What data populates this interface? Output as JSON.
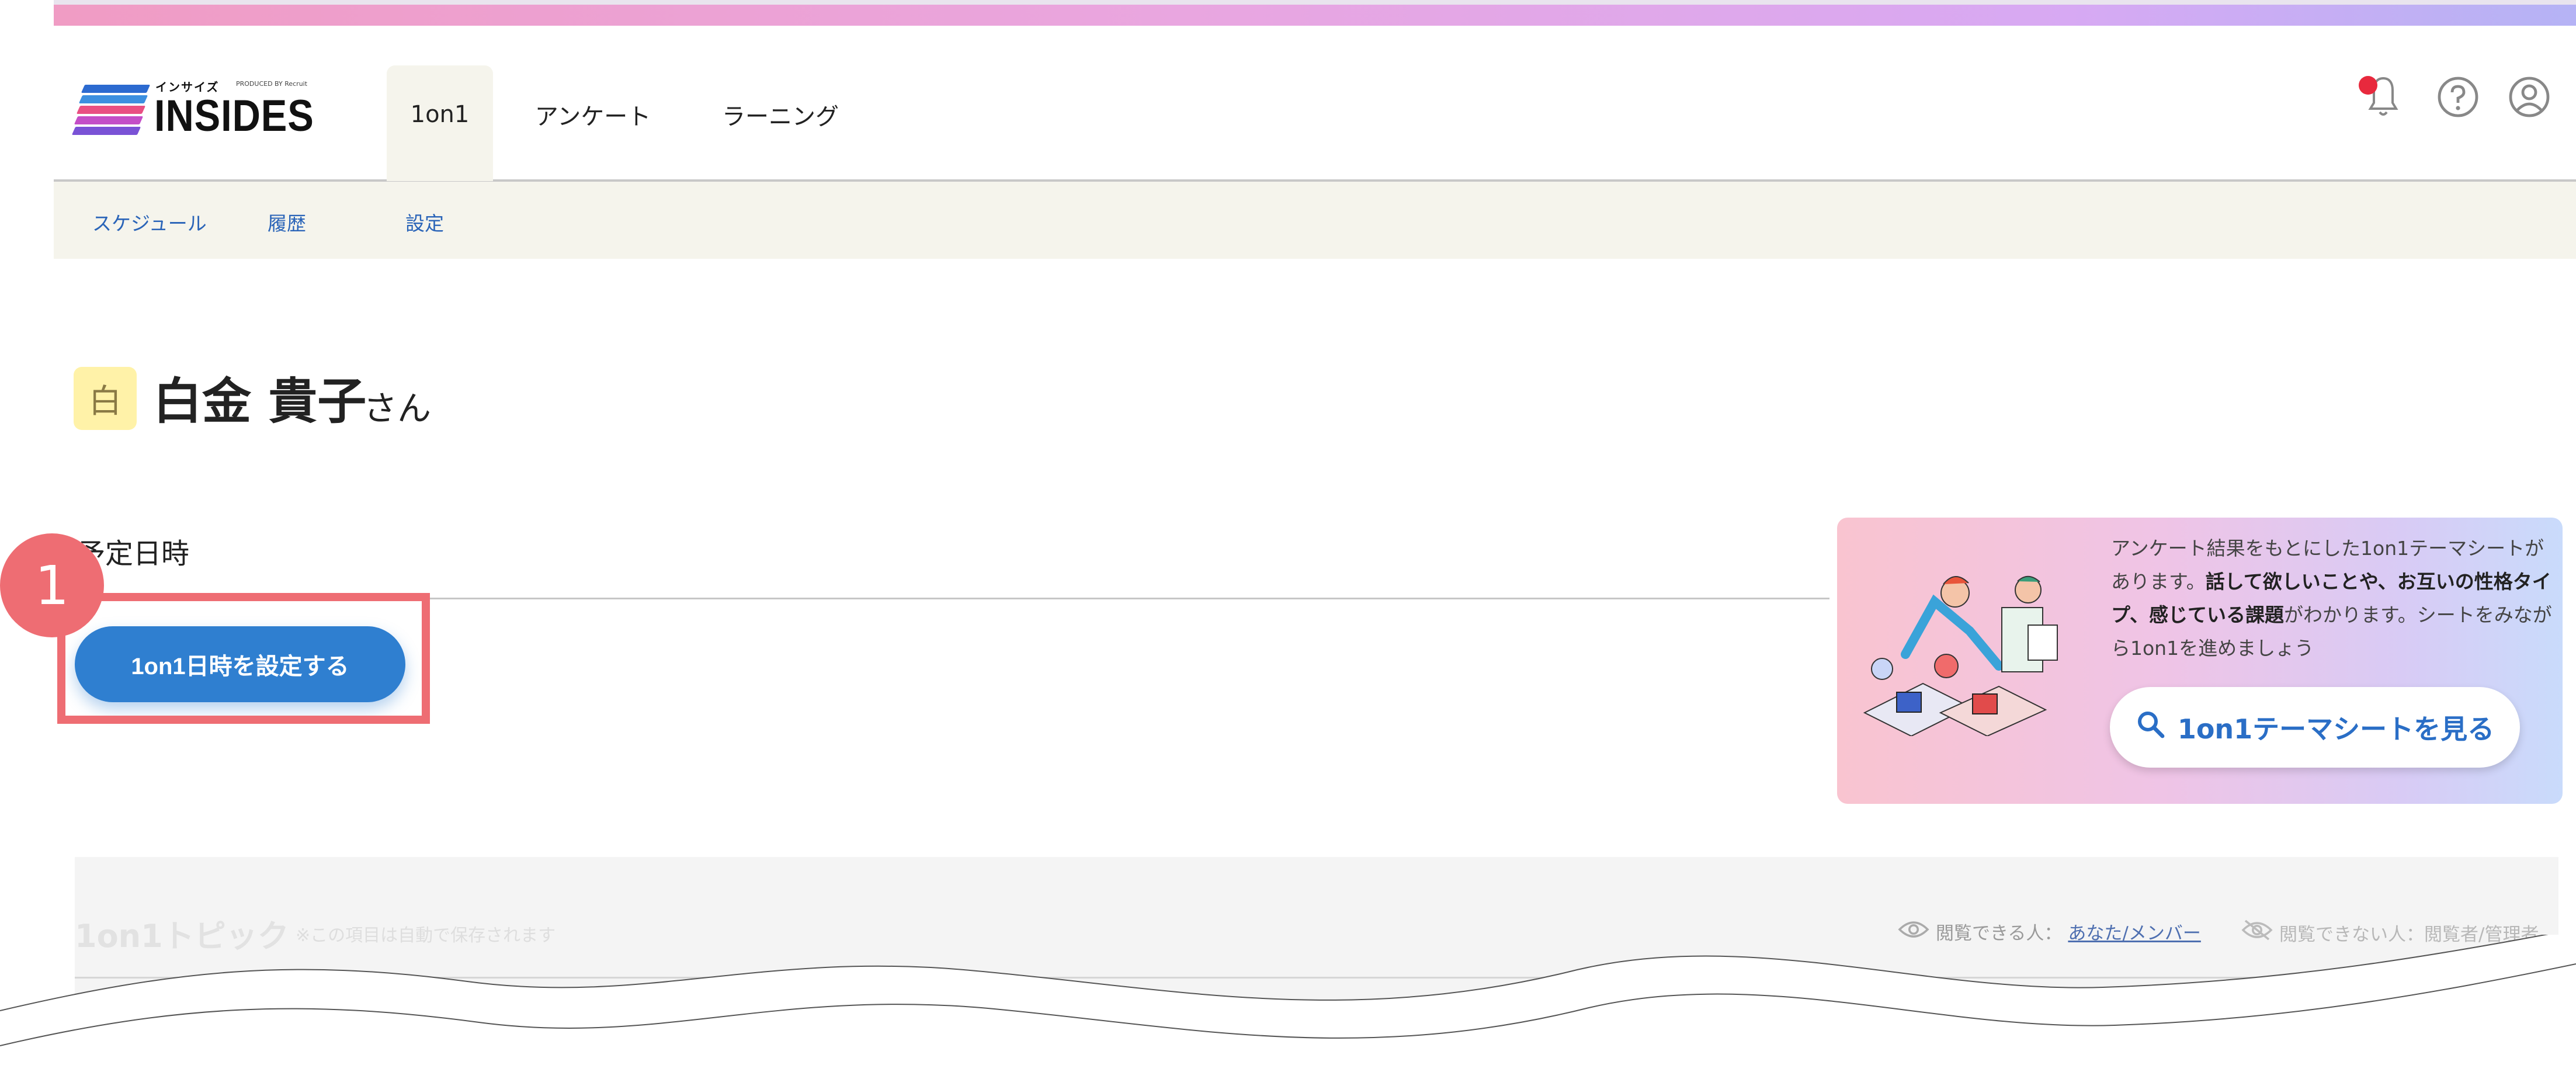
{
  "brand": {
    "logo_kana": "インサイズ",
    "logo_produced_by": "PRODUCED BY Recruit",
    "logo_text": "INSIDES"
  },
  "nav": {
    "tabs": [
      {
        "label": "1on1",
        "active": true
      },
      {
        "label": "アンケート",
        "active": false
      },
      {
        "label": "ラーニング",
        "active": false
      }
    ],
    "icons": [
      "bell-icon",
      "help-icon",
      "account-icon"
    ]
  },
  "subnav": {
    "items": [
      {
        "label": "スケジュール"
      },
      {
        "label": "履歴"
      },
      {
        "label": "設定"
      }
    ]
  },
  "user": {
    "avatar_char": "白",
    "name": "白金 貴子",
    "suffix": "さん"
  },
  "schedule": {
    "title": "予定日時",
    "step_number": "1",
    "set_button_label": "1on1日時を設定する"
  },
  "promo": {
    "text_1": "アンケート結果をもとにした1on1テーマシートがあります。",
    "text_bold_1": "話して欲しいことや、お互いの性格タイプ、感じている課題",
    "text_2": "がわかります。シートをみながら1on1を進めましょう",
    "button_label": "1on1テーマシートを見る"
  },
  "topic": {
    "title": "1on1トピック",
    "autosave_note": "※この項目は自動で保存されます",
    "visible_label": "閲覧できる人：",
    "visible_value": "あなた/メンバー",
    "invisible_label": "閲覧できない人：閲覧者/管理者"
  },
  "colors": {
    "accent_blue": "#2f7fd0",
    "highlight_red": "#ee6d73",
    "notification_red": "#e8293d",
    "subnav_bg": "#f5f4ec"
  }
}
